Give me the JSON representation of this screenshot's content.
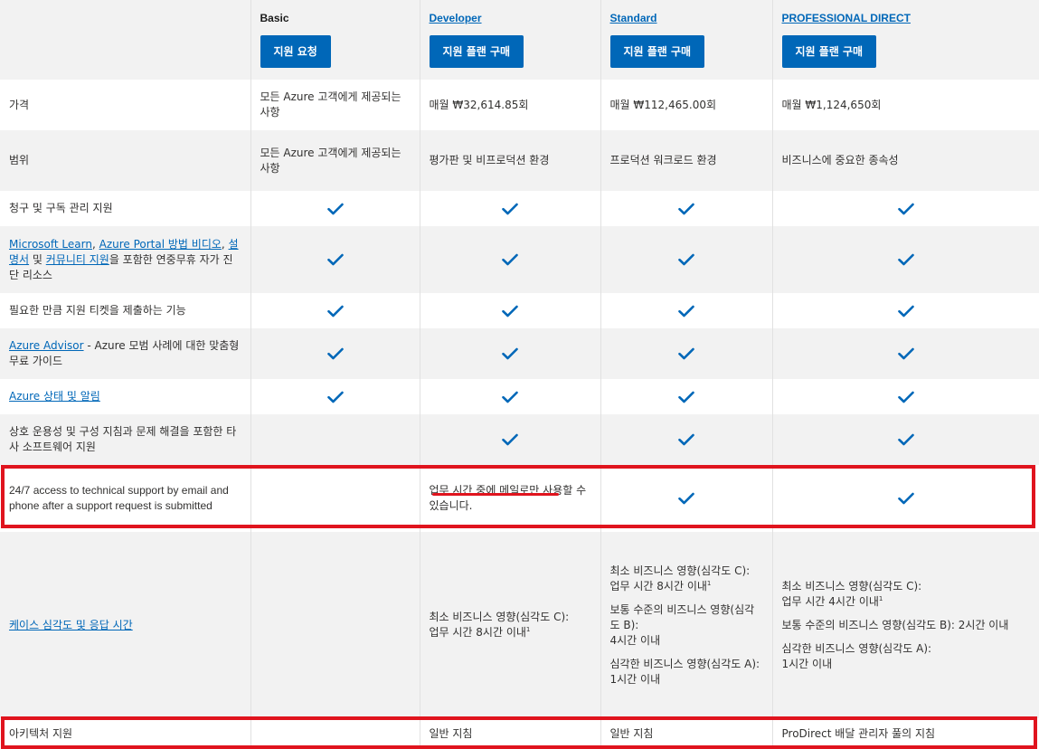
{
  "plans": [
    {
      "name": "Basic",
      "link": false,
      "button": "지원 요청"
    },
    {
      "name": "Developer",
      "link": true,
      "button": "지원 플랜 구매"
    },
    {
      "name": "Standard",
      "link": true,
      "button": "지원 플랜 구매"
    },
    {
      "name": "PROFESSIONAL DIRECT",
      "link": true,
      "button": "지원 플랜 구매"
    }
  ],
  "rows": {
    "price": {
      "label": "가격",
      "basic": "모든 Azure 고객에게 제공되는 사항",
      "developer": "매월 ₩32,614.85회",
      "standard": "매월 ₩112,465.00회",
      "prodirect": "매월 ₩1,124,650회"
    },
    "scope": {
      "label": "범위",
      "basic": "모든 Azure 고객에게 제공되는 사항",
      "developer": "평가판 및 비프로덕션 환경",
      "standard": "프로덕션 워크로드 환경",
      "prodirect": "비즈니스에 중요한 종속성"
    },
    "billing": {
      "label": "청구 및 구독 관리 지원"
    },
    "selfhelp": {
      "link1": "Microsoft Learn",
      "sep1": ", ",
      "link2": "Azure Portal 방법 비디오",
      "sep2": ", ",
      "link3": "설명서",
      "sep3": " 및 ",
      "link4": "커뮤니티 지원",
      "rest": "을 포함한 연중무휴 자가 진단 리소스"
    },
    "tickets": {
      "label": "필요한 만큼 지원 티켓을 제출하는 기능"
    },
    "advisor": {
      "link": "Azure Advisor",
      "rest": " - Azure 모범 사례에 대한 맞춤형 무료 가이드"
    },
    "health": {
      "link": "Azure 상태 및 알림"
    },
    "thirdparty": {
      "label": "상호 운용성 및 구성 지침과 문제 해결을 포함한 타사 소프트웨어 지원"
    },
    "access247": {
      "label": "24/7 access to technical support by email and phone after a support request is submitted",
      "developer": "업무 시간 중에 메일로만 사용할 수 있습니다."
    },
    "severity": {
      "link": "케이스 심각도 및 응답 시간",
      "developer": {
        "line1": "최소 비즈니스 영향(심각도 C):",
        "line2": "업무 시간 8시간 이내",
        "sup": "1"
      },
      "standard": {
        "c1": "최소 비즈니스 영향(심각도 C):",
        "c2": "업무 시간 8시간 이내",
        "csup": "1",
        "b1": "보통 수준의 비즈니스 영향(심각도 B):",
        "b2": "4시간 이내",
        "a1": "심각한 비즈니스 영향(심각도 A):",
        "a2": "1시간 이내"
      },
      "prodirect": {
        "c1": "최소 비즈니스 영향(심각도 C):",
        "c2": "업무 시간 4시간 이내",
        "csup": "1",
        "b1": "보통 수준의 비즈니스 영향(심각도 B): 2시간 이내",
        "a1": "심각한 비즈니스 영향(심각도 A):",
        "a2": "1시간 이내"
      }
    },
    "architecture": {
      "label": "아키텍처 지원",
      "developer": "일반 지침",
      "standard": "일반 지침",
      "prodirect": "ProDirect 배달 관리자 풀의 지침"
    }
  },
  "colors": {
    "accent": "#0067b8",
    "highlight": "#e0141e",
    "row_grey": "#f2f2f2"
  }
}
